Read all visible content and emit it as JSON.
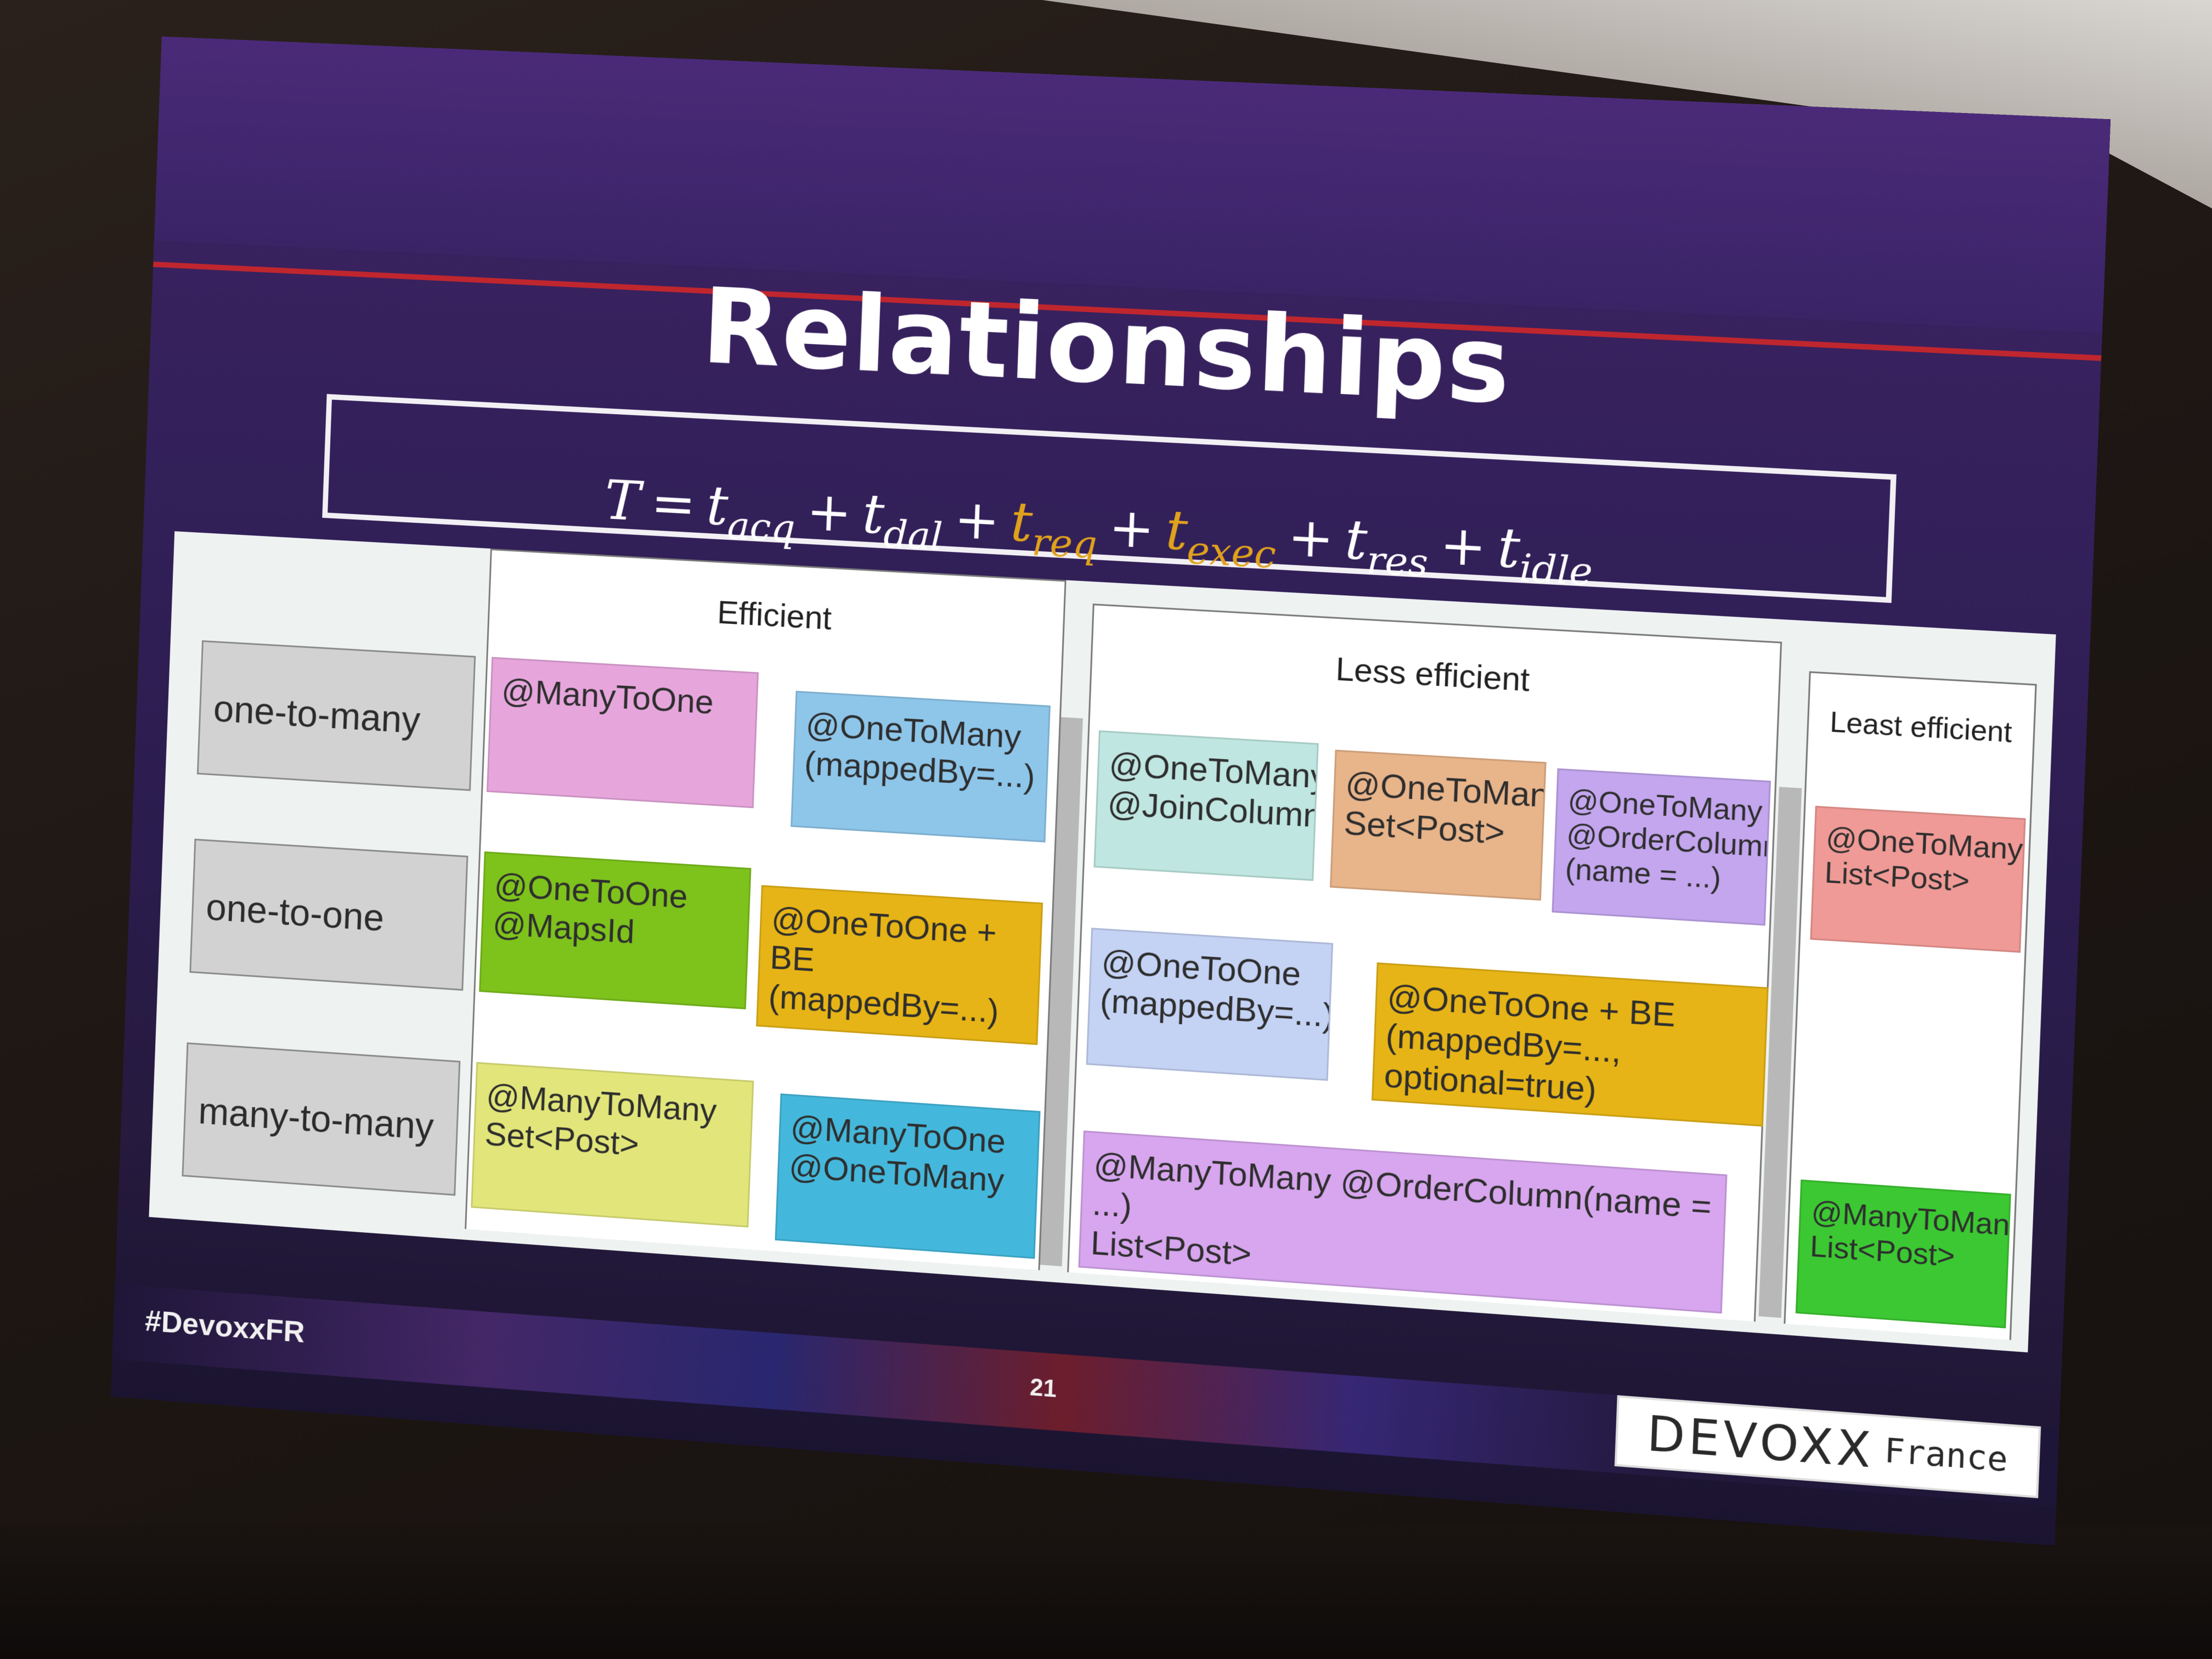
{
  "slide": {
    "title": "Relationships",
    "formula": {
      "lhs": "T",
      "equals": "=",
      "terms": [
        {
          "base": "t",
          "sub": "acq",
          "highlight": false
        },
        {
          "base": "t",
          "sub": "dal",
          "highlight": false
        },
        {
          "base": "t",
          "sub": "req",
          "highlight": true
        },
        {
          "base": "t",
          "sub": "exec",
          "highlight": true
        },
        {
          "base": "t",
          "sub": "res",
          "highlight": false
        },
        {
          "base": "t",
          "sub": "idle",
          "highlight": false
        }
      ],
      "plus": "+",
      "highlight_color": "#e0a21b"
    },
    "groups": {
      "efficient": "Efficient",
      "less_efficient": "Less efficient",
      "least_efficient": "Least efficient"
    },
    "rows": [
      {
        "label": "one-to-many"
      },
      {
        "label": "one-to-one"
      },
      {
        "label": "many-to-many"
      }
    ],
    "cells": {
      "o2m_manytoone": {
        "text": "@ManyToOne",
        "color": "#e6a6dc"
      },
      "o2m_onetomany_mapped": {
        "text": "@OneToMany\n(mappedBy=...)",
        "color": "#8ec6ea"
      },
      "o2m_joincolumn": {
        "text": "@OneToMany\n@JoinColumn",
        "color": "#bfe6e0"
      },
      "o2m_set": {
        "text": "@OneToMany\nSet<Post>",
        "color": "#e8b48a"
      },
      "o2m_ordercolumn": {
        "text": "@OneToMany\n@OrderColumn\n(name = ...)",
        "color": "#c3a6ee"
      },
      "o2m_list": {
        "text": "@OneToMany\nList<Post>",
        "color": "#ef9a96"
      },
      "o2o_mapsid": {
        "text": "@OneToOne\n@MapsId",
        "color": "#7ec21c"
      },
      "o2o_be_mapped": {
        "text": "@OneToOne + BE\n(mappedBy=...)",
        "color": "#e6b416"
      },
      "o2o_mapped": {
        "text": "@OneToOne\n(mappedBy=...)",
        "color": "#c4d2f4"
      },
      "o2o_be_optional": {
        "text": "@OneToOne + BE\n(mappedBy=..., optional=true)",
        "color": "#e6b416"
      },
      "m2m_set": {
        "text": "@ManyToMany\nSet<Post>",
        "color": "#e2e67a"
      },
      "m2m_manytoone_onetomany": {
        "text": "@ManyToOne\n@OneToMany",
        "color": "#44b8dc"
      },
      "m2m_ordercolumn": {
        "text": "@ManyToMany @OrderColumn(name = ...)\nList<Post>",
        "color": "#d7a6ee"
      },
      "m2m_list": {
        "text": "@ManyToMany\nList<Post>",
        "color": "#3cc832"
      }
    },
    "footer": {
      "hashtag": "#DevoxxFR",
      "page_number": "21",
      "logo_text": "DEVOXX",
      "logo_sub": "France"
    }
  }
}
